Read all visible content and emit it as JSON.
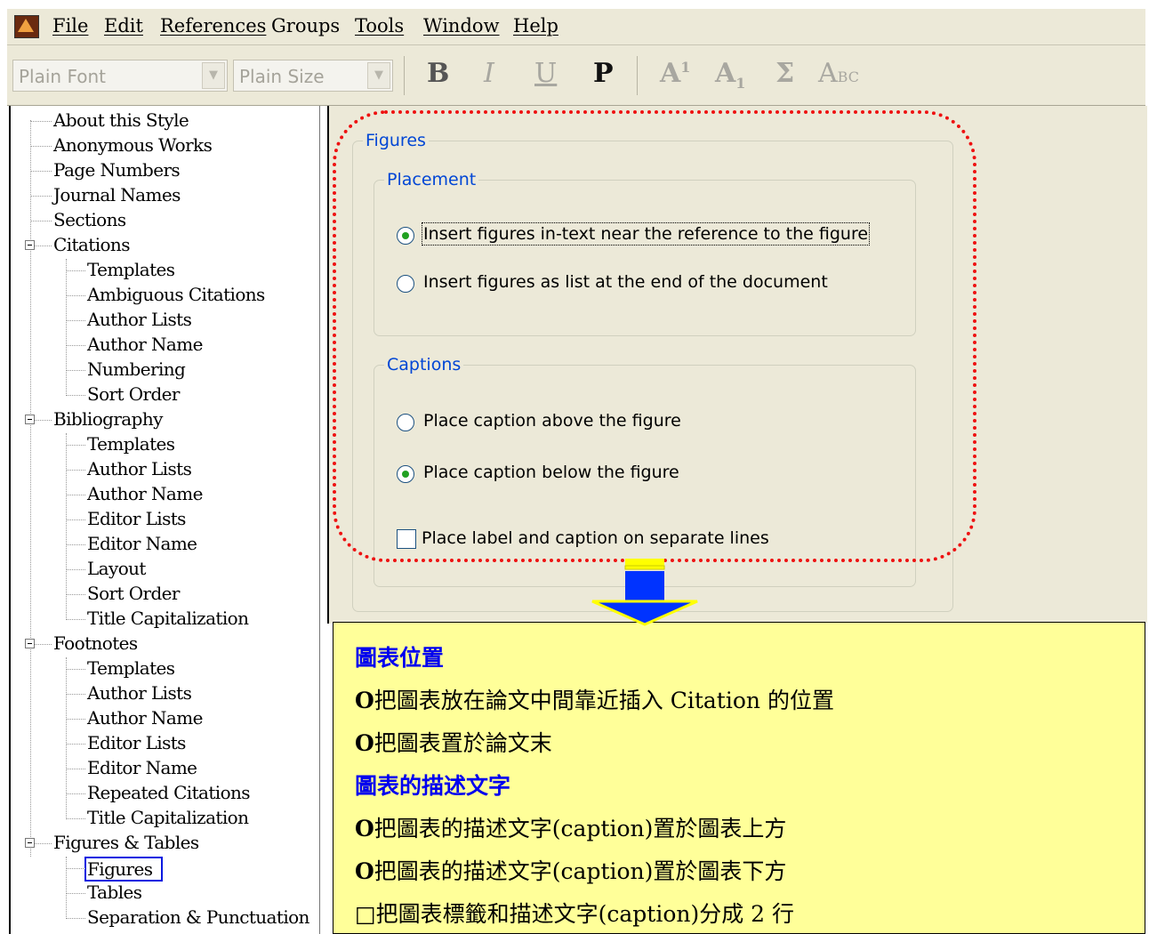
{
  "menu": {
    "items": [
      "File",
      "Edit",
      "References",
      "Groups",
      "Tools",
      "Window",
      "Help"
    ]
  },
  "toolbar": {
    "font_value": "Plain Font",
    "size_value": "Plain Size",
    "bold": "B",
    "italic": "I",
    "underline": "U",
    "plain": "P",
    "superscript": "A",
    "superscript_mark": "1",
    "subscript": "A",
    "subscript_mark": "1",
    "symbol": "Σ",
    "smallcaps_a": "A",
    "smallcaps_bc": "BC"
  },
  "tree": {
    "items": [
      "About this Style",
      "Anonymous Works",
      "Page Numbers",
      "Journal Names",
      "Sections",
      "Citations",
      "Templates",
      "Ambiguous Citations",
      "Author Lists",
      "Author Name",
      "Numbering",
      "Sort Order",
      "Bibliography",
      "Templates",
      "Author Lists",
      "Author Name",
      "Editor Lists",
      "Editor Name",
      "Layout",
      "Sort Order",
      "Title Capitalization",
      "Footnotes",
      "Templates",
      "Author Lists",
      "Author Name",
      "Editor Lists",
      "Editor Name",
      "Repeated Citations",
      "Title Capitalization",
      "Figures & Tables",
      "Figures",
      "Tables",
      "Separation & Punctuation"
    ],
    "selected": "Figures"
  },
  "panel": {
    "group_title": "Figures",
    "placement_title": "Placement",
    "placement_options": [
      "Insert figures in-text near the reference to the figure",
      "Insert figures as list at the end of the document"
    ],
    "captions_title": "Captions",
    "caption_options": [
      "Place caption above the figure",
      "Place caption below the figure"
    ],
    "separate_lines_label": "Place label and caption on separate lines"
  },
  "colors": {
    "highlight": "#ee1111",
    "note_bg": "#ffff99",
    "note_heading": "#0000ee",
    "group_label": "#0046d5",
    "arrow": "#0033ff",
    "arrow_base": "#ffff00"
  },
  "note": {
    "heading1": "圖表位置",
    "line1": "把圖表放在論文中間靠近插入 Citation 的位置",
    "line2": "把圖表置於論文末",
    "heading2": "圖表的描述文字",
    "line3": "把圖表的描述文字(caption)置於圖表上方",
    "line4": "把圖表的描述文字(caption)置於圖表下方",
    "line5": "把圖表標籤和描述文字(caption)分成 2 行",
    "marker_circle": "O",
    "marker_square": "□"
  }
}
